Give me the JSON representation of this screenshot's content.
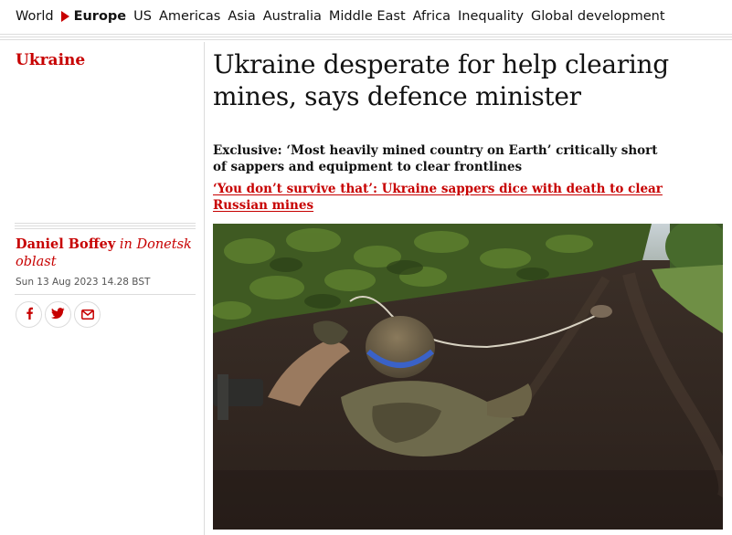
{
  "nav": {
    "items": [
      "World",
      "Europe",
      "US",
      "Americas",
      "Asia",
      "Australia",
      "Middle East",
      "Africa",
      "Inequality",
      "Global development"
    ],
    "active": "Europe"
  },
  "article": {
    "section": "Ukraine",
    "headline": "Ukraine desperate for help clearing mines, says defence minister",
    "standfirst": "Exclusive: ‘Most heavily mined country on Earth’ critically short of sappers and equipment to clear frontlines",
    "related_link": "‘You don’t survive that’: Ukraine sappers dice with death to clear Russian mines",
    "author_name": "Daniel Boffey",
    "author_location": "in Donetsk oblast",
    "date": "Sun 13 Aug 2023 14.28 BST"
  },
  "share": {
    "icons": [
      "facebook-icon",
      "twitter-icon",
      "email-icon"
    ]
  },
  "colors": {
    "accent": "#c70000",
    "text": "#121212",
    "rule": "#dcdcdc"
  }
}
